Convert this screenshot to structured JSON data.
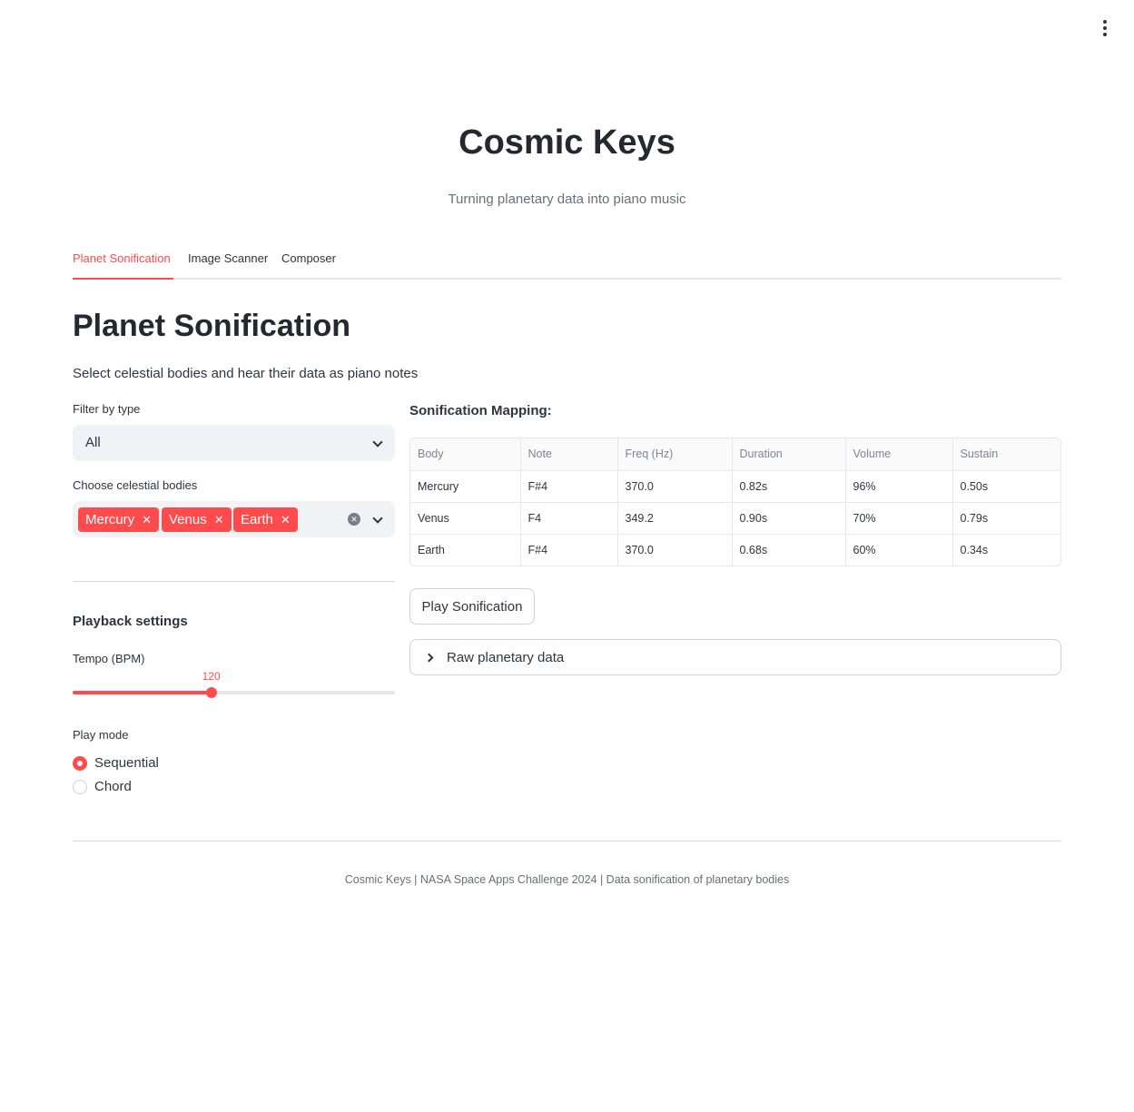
{
  "app": {
    "title": "Cosmic Keys",
    "subtitle": "Turning planetary data into piano music"
  },
  "tabs": [
    {
      "label": "Planet Sonification",
      "active": true
    },
    {
      "label": "Image Scanner",
      "active": false
    },
    {
      "label": "Composer",
      "active": false
    }
  ],
  "section": {
    "title": "Planet Sonification",
    "description": "Select celestial bodies and hear their data as piano notes"
  },
  "filter": {
    "label": "Filter by type",
    "value": "All"
  },
  "bodies": {
    "label": "Choose celestial bodies",
    "selected": [
      "Mercury",
      "Venus",
      "Earth"
    ],
    "remove_glyph": "✕",
    "clear_glyph": "✕"
  },
  "playback": {
    "title": "Playback settings",
    "tempo_label": "Tempo (BPM)",
    "tempo_value": "120",
    "tempo_fraction": 0.43,
    "mode_label": "Play mode",
    "modes": [
      {
        "label": "Sequential",
        "selected": true
      },
      {
        "label": "Chord",
        "selected": false
      }
    ]
  },
  "mapping": {
    "title": "Sonification Mapping:",
    "columns": [
      "Body",
      "Note",
      "Freq (Hz)",
      "Duration",
      "Volume",
      "Sustain"
    ],
    "rows": [
      [
        "Mercury",
        "F#4",
        "370.0",
        "0.82s",
        "96%",
        "0.50s"
      ],
      [
        "Venus",
        "F4",
        "349.2",
        "0.90s",
        "70%",
        "0.79s"
      ],
      [
        "Earth",
        "F#4",
        "370.0",
        "0.68s",
        "60%",
        "0.34s"
      ]
    ]
  },
  "play_button": "Play Sonification",
  "expander": "Raw planetary data",
  "footer": "Cosmic Keys | NASA Space Apps Challenge 2024 | Data sonification of planetary bodies",
  "colors": {
    "accent": "#ff4b4b",
    "text": "#31333f",
    "muted": "#6b6e78",
    "input_bg": "#f0f2f6"
  },
  "icons": {
    "menu": "vertical-dots-icon",
    "dropdown": "chevron-down-icon",
    "remove": "close-icon",
    "clear": "clear-circle-icon",
    "expander": "chevron-right-icon"
  }
}
